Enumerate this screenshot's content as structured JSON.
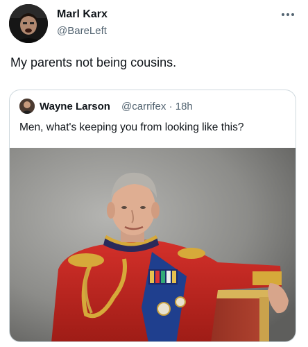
{
  "tweet": {
    "author_name": "Marl Karx",
    "author_handle": "@BareLeft",
    "text": "My parents not being cousins.",
    "more_icon": "more-horizontal-icon"
  },
  "quoted_tweet": {
    "author_name": "Wayne Larson",
    "author_handle": "@carrifex",
    "separator": "·",
    "time": "18h",
    "text": "Men, what's keeping you from looking like this?",
    "image_description": "portrait-photo"
  },
  "colors": {
    "primary_text": "#0f1419",
    "secondary_text": "#536471",
    "border": "#cfd9de",
    "uniform_red": "#c0261c",
    "gold": "#d6a93a",
    "sash_blue": "#1f3f8e"
  }
}
